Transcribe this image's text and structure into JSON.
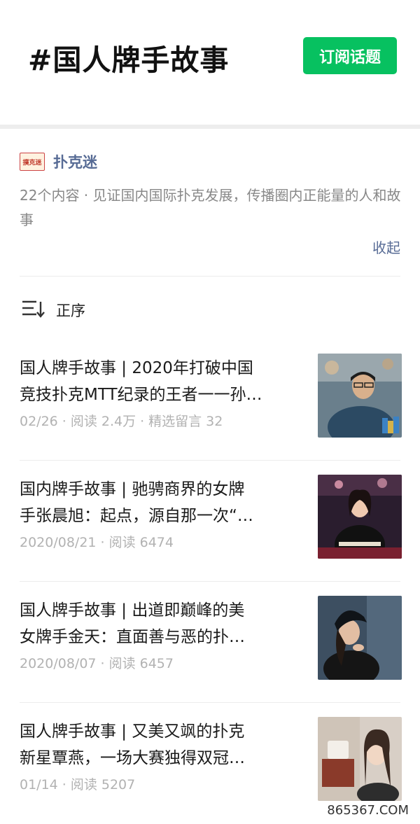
{
  "header": {
    "topic_title": "#国人牌手故事",
    "subscribe_label": "订阅话题"
  },
  "account": {
    "logo_text": "撲克迷",
    "name": "扑克迷",
    "description": "22个内容 · 见证国内国际扑克发展，传播圈内正能量的人和故事",
    "collapse_label": "收起"
  },
  "sort": {
    "label": "正序"
  },
  "articles": [
    {
      "title_line1": "国人牌手故事 | 2020年打破中国",
      "title_line2": "竞技扑克MTT纪录的王者一一孙…",
      "date": "02/26",
      "reads": "阅读 2.4万",
      "comments": "精选留言 32"
    },
    {
      "title_line1": "国内牌手故事 | 驰骋商界的女牌",
      "title_line2": "手张晨旭：起点，源自那一次“…",
      "date": "2020/08/21",
      "reads": "阅读 6474"
    },
    {
      "title_line1": "国人牌手故事 | 出道即巅峰的美",
      "title_line2": "女牌手金天：直面善与恶的扑…",
      "date": "2020/08/07",
      "reads": "阅读 6457"
    },
    {
      "title_line1": "国人牌手故事 | 又美又飒的扑克",
      "title_line2": "新星覃燕，一场大赛独得双冠…",
      "date": "01/14",
      "reads": "阅读 5207"
    }
  ],
  "watermark": "865367.COM",
  "colors": {
    "accent_green": "#07c160",
    "link_blue": "#576b95",
    "meta_gray": "#b2b2b2"
  }
}
